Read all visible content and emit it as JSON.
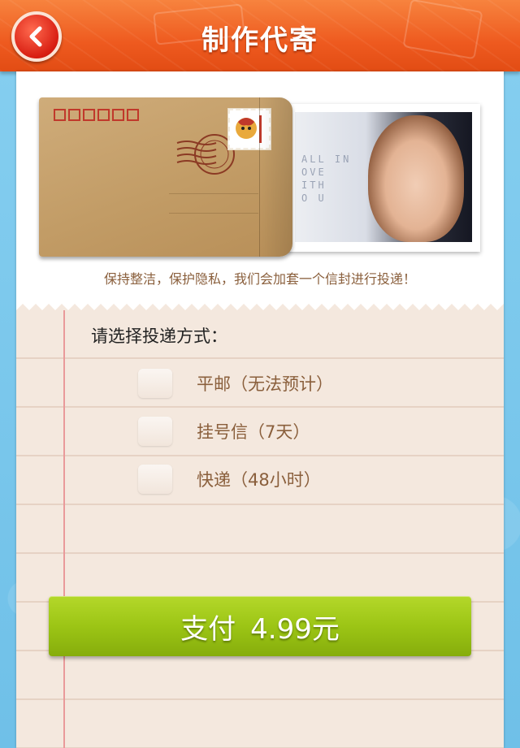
{
  "header": {
    "title": "制作代寄",
    "back_icon": "chevron-left-icon"
  },
  "envelope": {
    "photo_text": "ALL IN\nOVE\nITH\nO U",
    "caption": "保持整洁，保护隐私，我们会加套一个信封进行投递！"
  },
  "delivery": {
    "prompt": "请选择投递方式：",
    "options": [
      {
        "label": "平邮（无法预计）"
      },
      {
        "label": "挂号信（7天）"
      },
      {
        "label": "快递（48小时）"
      }
    ]
  },
  "pay": {
    "label": "支付",
    "amount": "4.99元"
  },
  "colors": {
    "header": "#ee5a1f",
    "accent_green": "#9cc515",
    "text_brown": "#8a5f3c"
  }
}
